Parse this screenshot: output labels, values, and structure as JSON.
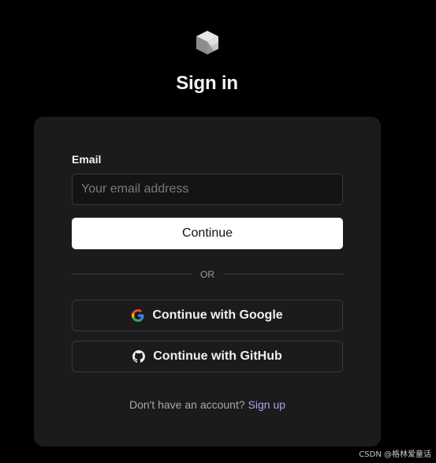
{
  "header": {
    "logo_icon": "cube-logo-icon",
    "title": "Sign in"
  },
  "form": {
    "email_label": "Email",
    "email_value": "",
    "email_placeholder": "Your email address",
    "continue_label": "Continue",
    "divider_text": "OR",
    "google_label": "Continue with Google",
    "google_icon": "google-icon",
    "github_label": "Continue with GitHub",
    "github_icon": "github-icon"
  },
  "footer": {
    "prompt_text": "Don't have an account?",
    "signup_link": "Sign up"
  },
  "watermark": "CSDN @格林爱童话",
  "colors": {
    "page_background": "#000000",
    "card_background": "#1b1b1b",
    "primary_button": "#ffffff",
    "link": "#a9a4f2",
    "border": "#3a3a3a"
  }
}
